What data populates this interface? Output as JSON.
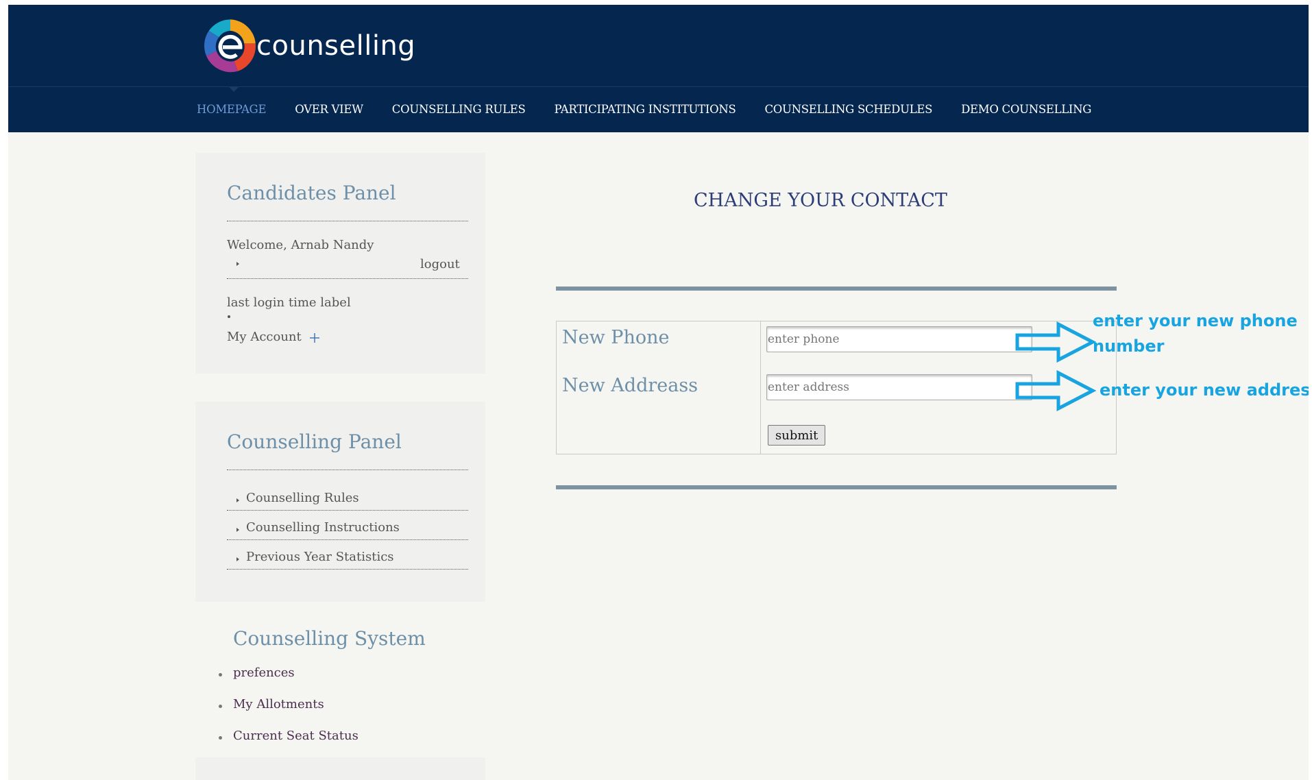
{
  "brand": {
    "name": "counselling"
  },
  "nav": {
    "items": [
      {
        "label": "HOMEPAGE",
        "active": true
      },
      {
        "label": "OVER VIEW",
        "active": false
      },
      {
        "label": "COUNSELLING RULES",
        "active": false
      },
      {
        "label": "PARTICIPATING INSTITUTIONS",
        "active": false
      },
      {
        "label": "COUNSELLING SCHEDULES",
        "active": false
      },
      {
        "label": "DEMO COUNSELLING",
        "active": false
      }
    ]
  },
  "candidates_panel": {
    "title": "Candidates Panel",
    "welcome": "Welcome, Arnab Nandy",
    "logout": "logout",
    "last_login": "last login time label",
    "my_account": "My Account"
  },
  "counselling_panel": {
    "title": "Counselling Panel",
    "links": [
      "Counselling Rules",
      "Counselling Instructions",
      "Previous Year Statistics"
    ]
  },
  "counselling_system": {
    "title": "Counselling System",
    "items": [
      "prefences",
      "My Allotments",
      "Current Seat Status"
    ]
  },
  "main": {
    "title": "CHANGE YOUR CONTACT",
    "phone_label": "New Phone",
    "phone_placeholder": "enter phone",
    "address_label": "New Addreass",
    "address_placeholder": "enter address",
    "submit_label": "submit"
  },
  "annotations": {
    "phone_line1": "enter your new phone",
    "phone_line2": "number",
    "address": "enter your new address",
    "color": "#18a4e0"
  },
  "colors": {
    "header_bg": "#05264e",
    "nav_active": "#6f9bd6",
    "panel_heading": "#6e8fa8",
    "page_bg": "#f5f6f1"
  }
}
